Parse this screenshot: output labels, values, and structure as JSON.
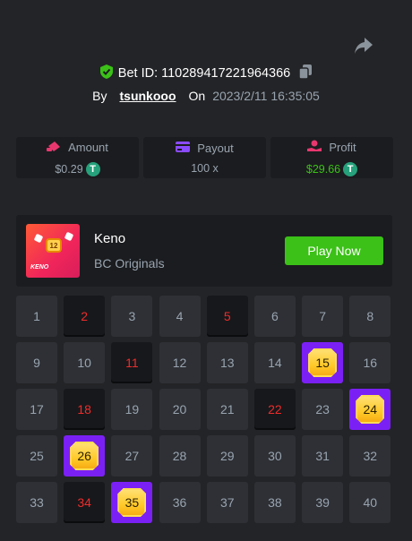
{
  "header": {
    "bet_id_label": "Bet ID: 110289417221964366",
    "by_label": "By",
    "username": "tsunkooo",
    "on_label": "On",
    "timestamp": "2023/2/11 16:35:05"
  },
  "stats": [
    {
      "label": "Amount",
      "value": "$0.29",
      "icon": "amount-icon"
    },
    {
      "label": "Payout",
      "value": "100 x",
      "icon": "payout-icon"
    },
    {
      "label": "Profit",
      "value": "$29.66",
      "icon": "profit-icon"
    }
  ],
  "game": {
    "thumb_number": "12",
    "thumb_text": "KENO",
    "name": "Keno",
    "subtitle": "BC Originals",
    "play_label": "Play Now"
  },
  "colors": {
    "background": "#232427",
    "panel": "#1b1c1f",
    "cell": "#2e3035",
    "drawn_text": "#ed2c2c",
    "hit_bg": "#7b20f5",
    "accent_green": "#3bc117",
    "muted": "#99a4b0"
  },
  "board": {
    "numbers": [
      "1",
      "2",
      "3",
      "4",
      "5",
      "6",
      "7",
      "8",
      "9",
      "10",
      "11",
      "12",
      "13",
      "14",
      "15",
      "16",
      "17",
      "18",
      "19",
      "20",
      "21",
      "22",
      "23",
      "24",
      "25",
      "26",
      "27",
      "28",
      "29",
      "30",
      "31",
      "32",
      "33",
      "34",
      "35",
      "36",
      "37",
      "38",
      "39",
      "40"
    ],
    "drawn": [
      "2",
      "5",
      "11",
      "18",
      "22",
      "34"
    ],
    "hits": [
      "15",
      "24",
      "26",
      "35"
    ]
  }
}
